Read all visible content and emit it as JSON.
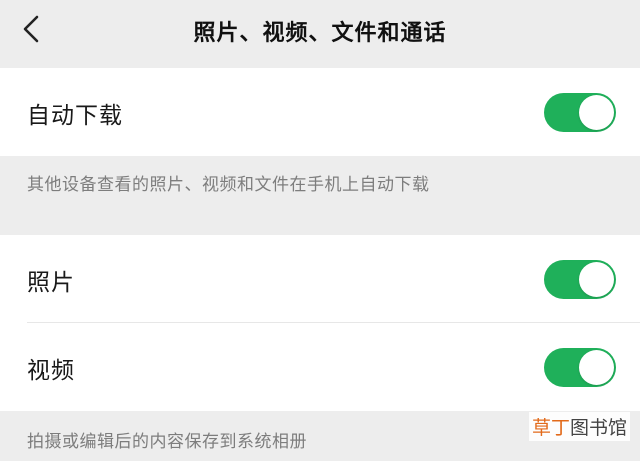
{
  "navbar": {
    "title": "照片、视频、文件和通话",
    "back_icon": "chevron-left-icon"
  },
  "auto_download": {
    "label": "自动下载",
    "enabled": true,
    "description": "其他设备查看的照片、视频和文件在手机上自动下载"
  },
  "media_settings": {
    "items": [
      {
        "label": "照片",
        "enabled": true
      },
      {
        "label": "视频",
        "enabled": true
      }
    ],
    "description": "拍摄或编辑后的内容保存到系统相册"
  },
  "watermark": {
    "accent_text": "草丁",
    "text": "图书馆"
  },
  "colors": {
    "background": "#ededed",
    "card": "#ffffff",
    "toggle_on": "#1fb05a",
    "footnote_text": "#7d7d7d"
  }
}
